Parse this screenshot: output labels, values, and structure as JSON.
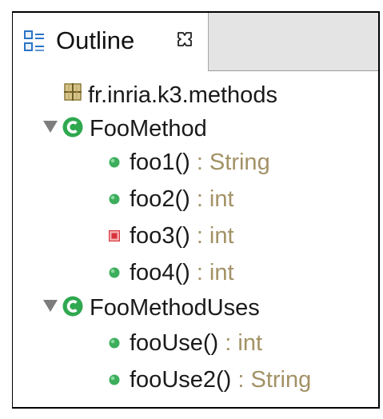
{
  "tab": {
    "title": "Outline",
    "icon": "outline-view-icon",
    "close_icon": "close-icon"
  },
  "tree": {
    "package": {
      "label": "fr.inria.k3.methods",
      "icon": "package-icon"
    },
    "classes": [
      {
        "name": "FooMethod",
        "icon": "class-icon",
        "expanded": true,
        "methods": [
          {
            "name": "foo1()",
            "type": " : String",
            "visibility": "public",
            "icon": "public-method-icon"
          },
          {
            "name": "foo2()",
            "type": " : int",
            "visibility": "public",
            "icon": "public-method-icon"
          },
          {
            "name": "foo3()",
            "type": " : int",
            "visibility": "private",
            "icon": "private-method-icon"
          },
          {
            "name": "foo4()",
            "type": " : int",
            "visibility": "public",
            "icon": "public-method-icon"
          }
        ]
      },
      {
        "name": "FooMethodUses",
        "icon": "class-icon",
        "expanded": true,
        "methods": [
          {
            "name": "fooUse()",
            "type": " : int",
            "visibility": "public",
            "icon": "public-method-icon"
          },
          {
            "name": "fooUse2()",
            "type": " : String",
            "visibility": "public",
            "icon": "public-method-icon"
          }
        ]
      }
    ]
  },
  "colors": {
    "public_method": "#3cae5c",
    "private_method": "#d9323a",
    "class": "#2fa84f",
    "type_text": "#a39266",
    "twisty": "#7d7d7d"
  }
}
